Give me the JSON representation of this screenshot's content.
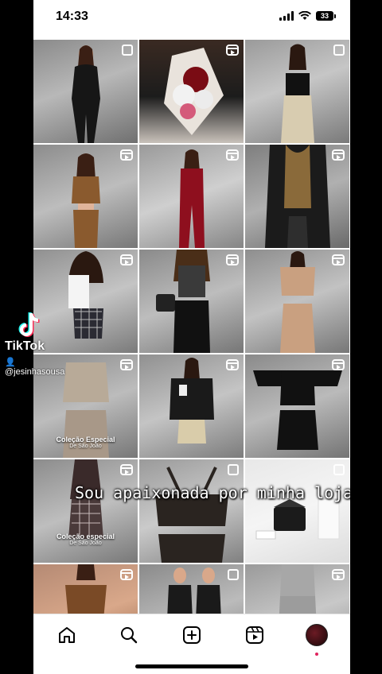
{
  "status_bar": {
    "time": "14:33",
    "battery": "33"
  },
  "tiktok": {
    "brand": "TikTok",
    "username": "@jesinhasousa"
  },
  "caption": {
    "text": "Sou apaixonada por minha loja"
  },
  "grid": {
    "tiles": [
      {
        "type": "post"
      },
      {
        "type": "reel"
      },
      {
        "type": "post"
      },
      {
        "type": "reel"
      },
      {
        "type": "reel"
      },
      {
        "type": "reel"
      },
      {
        "type": "reel"
      },
      {
        "type": "reel"
      },
      {
        "type": "reel"
      },
      {
        "type": "reel",
        "promo_title": "Coleção Especial",
        "promo_sub": "De São João"
      },
      {
        "type": "reel"
      },
      {
        "type": "reel"
      },
      {
        "type": "reel",
        "promo_title": "Coleção especial",
        "promo_sub": "De São João"
      },
      {
        "type": "post"
      },
      {
        "type": "post"
      },
      {
        "type": "reel"
      },
      {
        "type": "post"
      },
      {
        "type": "reel"
      }
    ]
  },
  "bottom_nav": {
    "items": [
      {
        "icon": "home-icon"
      },
      {
        "icon": "search-icon"
      },
      {
        "icon": "create-icon"
      },
      {
        "icon": "reels-icon"
      },
      {
        "icon": "profile-avatar"
      }
    ]
  },
  "colors": {
    "heart": "#111111",
    "tiktok_cyan": "#25F4EE",
    "tiktok_red": "#FE2C55",
    "notification_dot": "#e0245e"
  }
}
